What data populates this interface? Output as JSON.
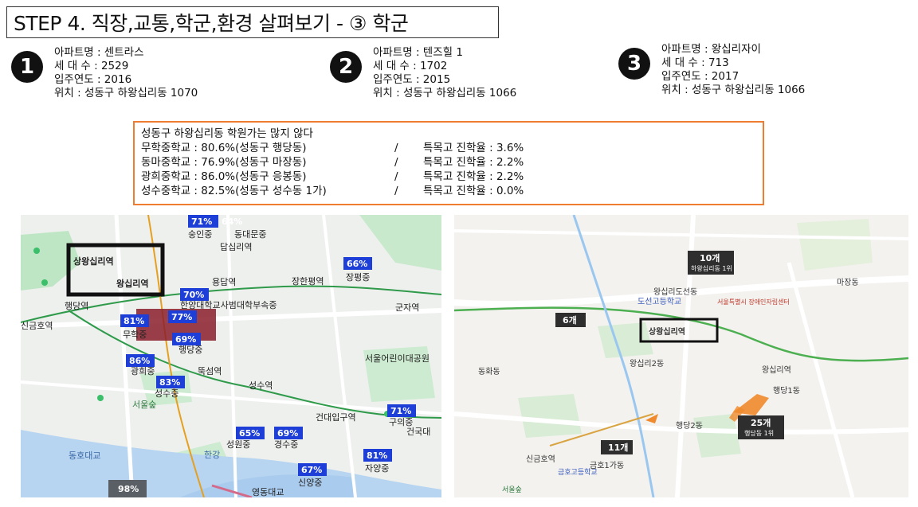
{
  "title": "STEP 4. 직장,교통,학군,환경 살펴보기 - ③ 학군",
  "apartments": [
    {
      "badge": "1",
      "name": "아파트명 : 센트라스",
      "households": "세 대 수  : 2529",
      "year": "입주연도 : 2016",
      "location": "위치 : 성동구 하왕십리동 1070"
    },
    {
      "badge": "2",
      "name": "아파트명 : 텐즈힐 1",
      "households": "세 대 수  : 1702",
      "year": "입주연도 : 2015",
      "location": "위치 : 성동구 하왕십리동 1066"
    },
    {
      "badge": "3",
      "name": "아파트명 : 왕십리자이",
      "households": "세 대 수  : 713",
      "year": "입주연도 : 2017",
      "location": "위치 : 성동구 하왕십리동 1066"
    }
  ],
  "info": {
    "heading": "성동구 하왕십리동 학원가는 많지 않다",
    "schools": [
      {
        "left": "무학중학교 : 80.6%(성동구 행당동)",
        "sep": "/",
        "right": "특목고 진학율 : 3.6%"
      },
      {
        "left": "동마중학교 : 76.9%(성동구 마장동)",
        "sep": "/",
        "right": "특목고 진학율 : 2.2%"
      },
      {
        "left": "광희중학교 : 86.0%(성동구 응봉동)",
        "sep": "/",
        "right": "특목고 진학율 : 2.2%"
      },
      {
        "left": "성수중학교 : 82.5%(성동구 성수동 1가)",
        "sep": "/",
        "right": "특목고 진학율 : 0.0%"
      }
    ]
  },
  "map_left": {
    "station_box": "상왕십리역",
    "labels": [
      "왕십리역",
      "행당역",
      "신금호역",
      "뚝섬역",
      "성수역",
      "건대입구역",
      "군자역",
      "장한평역",
      "용답역",
      "답십리역",
      "동대문중",
      "숭인중",
      "장평중",
      "한양대학교사범대학부속중",
      "행당중",
      "무학중",
      "광희중",
      "성수중",
      "성원중",
      "경수중",
      "신양중",
      "자양중",
      "구의중",
      "건국대",
      "서울어린이대공원",
      "한강",
      "동호대교",
      "영동대교",
      "서울숲"
    ],
    "badges": [
      "71%",
      "64%",
      "66%",
      "70%",
      "81%",
      "77%",
      "69%",
      "86%",
      "83%",
      "65%",
      "69%",
      "71%",
      "81%",
      "67%",
      "98%"
    ],
    "accent": "#1d3fd8"
  },
  "map_right": {
    "station_box": "상왕십리역",
    "tags": [
      {
        "count": "10개",
        "sub": "하왕십리동 1위"
      },
      {
        "count": "6개",
        "sub": ""
      },
      {
        "count": "25개",
        "sub": "행당동 1위"
      },
      {
        "count": "11개",
        "sub": ""
      }
    ],
    "labels": [
      "왕십리도선동",
      "왕십리2동",
      "행당1동",
      "행당2동",
      "마장동",
      "동화동",
      "신금호역",
      "왕십리역",
      "금호1가동",
      "도선고등학교",
      "서울특별시 장애인자립센터",
      "금호고등학교",
      "서울숲"
    ],
    "accent": "#f08a2c"
  }
}
